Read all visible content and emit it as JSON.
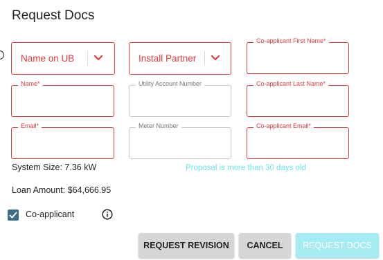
{
  "dialog": {
    "title": "Request Docs"
  },
  "selects": {
    "name_on_ub": {
      "label": "Name on UB"
    },
    "install_partner": {
      "label": "Install Partner"
    }
  },
  "fields": {
    "coapplicant_first_name": {
      "label": "Co-applicant First Name*",
      "value": ""
    },
    "name": {
      "label": "Name*",
      "value": ""
    },
    "utility_account_number": {
      "label": "Utility Account Number",
      "value": ""
    },
    "coapplicant_last_name": {
      "label": "Co-applicant Last Name*",
      "value": ""
    },
    "email": {
      "label": "Email*",
      "value": ""
    },
    "meter_number": {
      "label": "Meter Number",
      "value": ""
    },
    "coapplicant_email": {
      "label": "Co-applicant Email*",
      "value": ""
    }
  },
  "info": {
    "system_size": "System Size: 7.36 kW",
    "loan_amount": "Loan Amount: $64,666.95",
    "warning": "Proposal is more than 30 days old"
  },
  "coapplicant": {
    "label": "Co-applicant",
    "checked": true
  },
  "buttons": {
    "request_revision": "REQUEST REVISION",
    "cancel": "CANCEL",
    "request_docs": "REQUEST DOCS"
  },
  "icons": {
    "chevron": "chevron-down-icon",
    "info": "info-icon",
    "check": "check-icon"
  },
  "colors": {
    "error": "#e0393e",
    "warning_text": "#6be3ee",
    "primary_disabled": "#a4ecf1",
    "checkbox": "#3b6c88",
    "button_grey": "#d6d6d6"
  }
}
